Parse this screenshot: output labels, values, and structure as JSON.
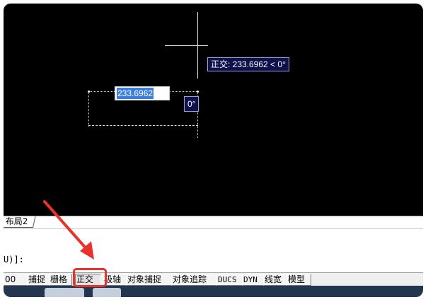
{
  "canvas": {
    "tooltip_text": "正交: 233.6962 < 0°",
    "input_value": "233.6962",
    "angle_text": "0°"
  },
  "layout_tab": {
    "label": "布局2"
  },
  "command": {
    "prompt_text": "U)]:"
  },
  "statusbar": {
    "coord_fragment": "00",
    "items": [
      "捕捉",
      "栅格",
      "正交",
      "极轴",
      "对象捕捉",
      "对象追踪",
      "DUCS",
      "DYN",
      "线宽",
      "模型"
    ]
  },
  "colors": {
    "highlight": "#e8322b",
    "tooltip_bg": "#10104c",
    "selection": "#3b7fdb"
  }
}
